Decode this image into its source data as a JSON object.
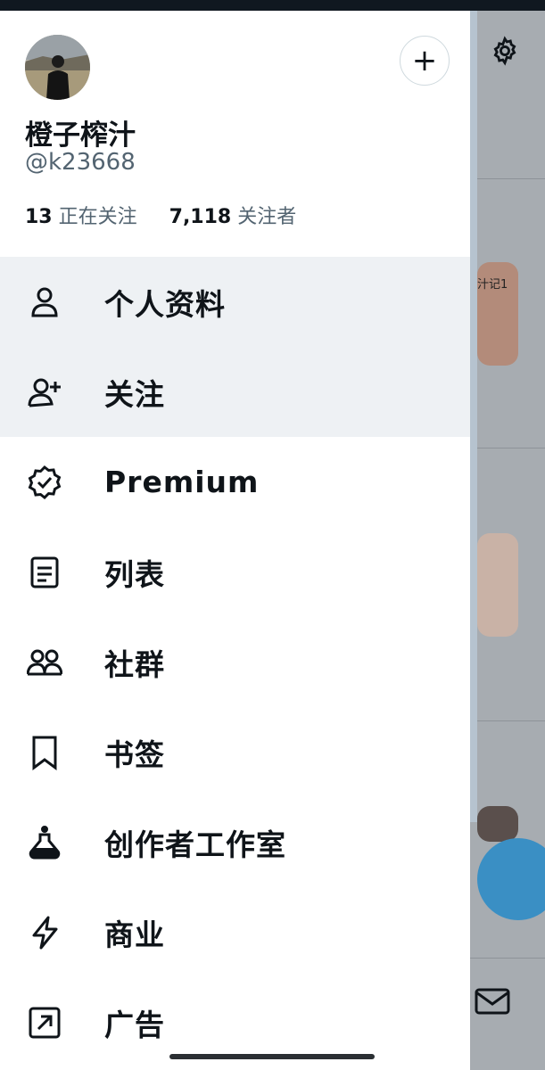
{
  "profile": {
    "name": "橙子榨汁",
    "handle": "@k23668",
    "following_count": "13",
    "following_label": "正在关注",
    "followers_count": "7,118",
    "followers_label": "关注者"
  },
  "menu": [
    {
      "label": "个人资料",
      "icon": "person-icon"
    },
    {
      "label": "关注",
      "icon": "person-add-icon"
    },
    {
      "label": "Premium",
      "icon": "verified-badge-icon"
    },
    {
      "label": "列表",
      "icon": "list-icon"
    },
    {
      "label": "社群",
      "icon": "communities-icon"
    },
    {
      "label": "书签",
      "icon": "bookmark-icon"
    },
    {
      "label": "创作者工作室",
      "icon": "flask-icon"
    },
    {
      "label": "商业",
      "icon": "lightning-icon"
    },
    {
      "label": "广告",
      "icon": "external-arrow-icon"
    }
  ],
  "background": {
    "thumb_caption": "汁记1"
  },
  "colors": {
    "text": "#0f1419",
    "muted": "#536471",
    "highlight": "#eef1f4",
    "accent": "#1d9bf0"
  }
}
